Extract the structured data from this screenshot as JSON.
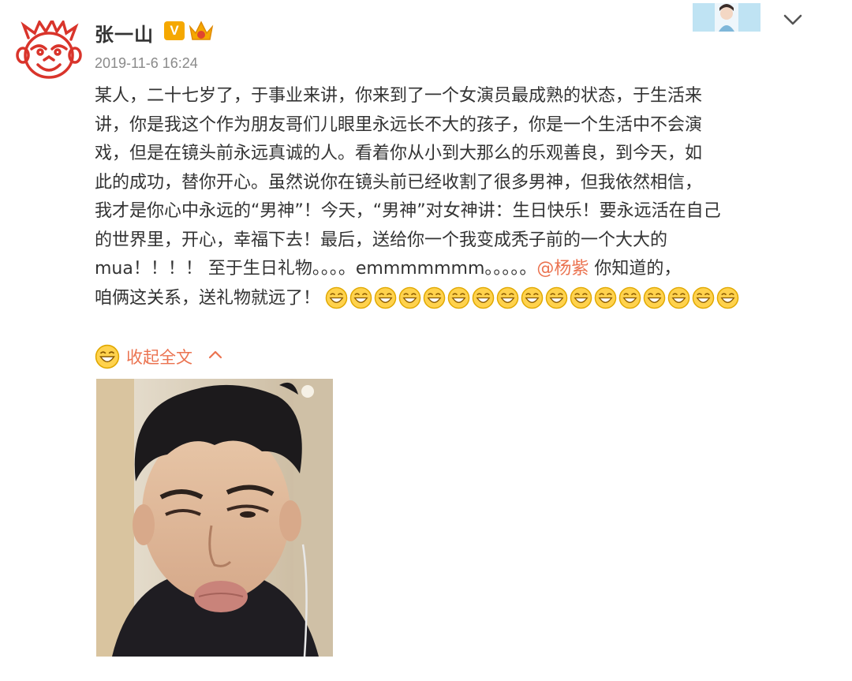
{
  "post": {
    "username": "张一山",
    "verified_badge": "V",
    "timestamp": "2019-11-6 16:24",
    "lines": [
      "某人，二十七岁了，于事业来讲，你来到了一个女演员最成熟的状态，于生活来",
      "讲，你是我这个作为朋友哥们儿眼里永远长不大的孩子，你是一个生活中不会演",
      "戏，但是在镜头前永远真诚的人。看着你从小到大那么的乐观善良，到今天，如",
      "此的成功，替你开心。虽然说你在镜头前已经收割了很多男神，但我依然相信，",
      "我才是你心中永远的“男神”！今天，“男神”对女神讲：生日快乐！要永远活在自己",
      "的世界里，开心，幸福下去！最后，送给你一个我变成秃子前的一个大大的"
    ],
    "line7_before": "mua！！！！ 至于生日礼物。。。。emmmmmmm。。。。。",
    "mention": "@杨紫",
    "line7_after": " 你知道的，",
    "line8": "咱俩这关系，送礼物就远了！",
    "collapse_label": "收起全文",
    "collapse_arrow": "^"
  },
  "icons": {
    "avatar": "monkey-king-avatar-icon",
    "crown": "crown-badge-icon",
    "chevron": "chevron-down-icon",
    "emoji": "laughing-emoji-icon"
  },
  "colors": {
    "mention": "#eb7350",
    "badge": "#f5a800",
    "text": "#333333",
    "meta": "#8a8a8a"
  }
}
